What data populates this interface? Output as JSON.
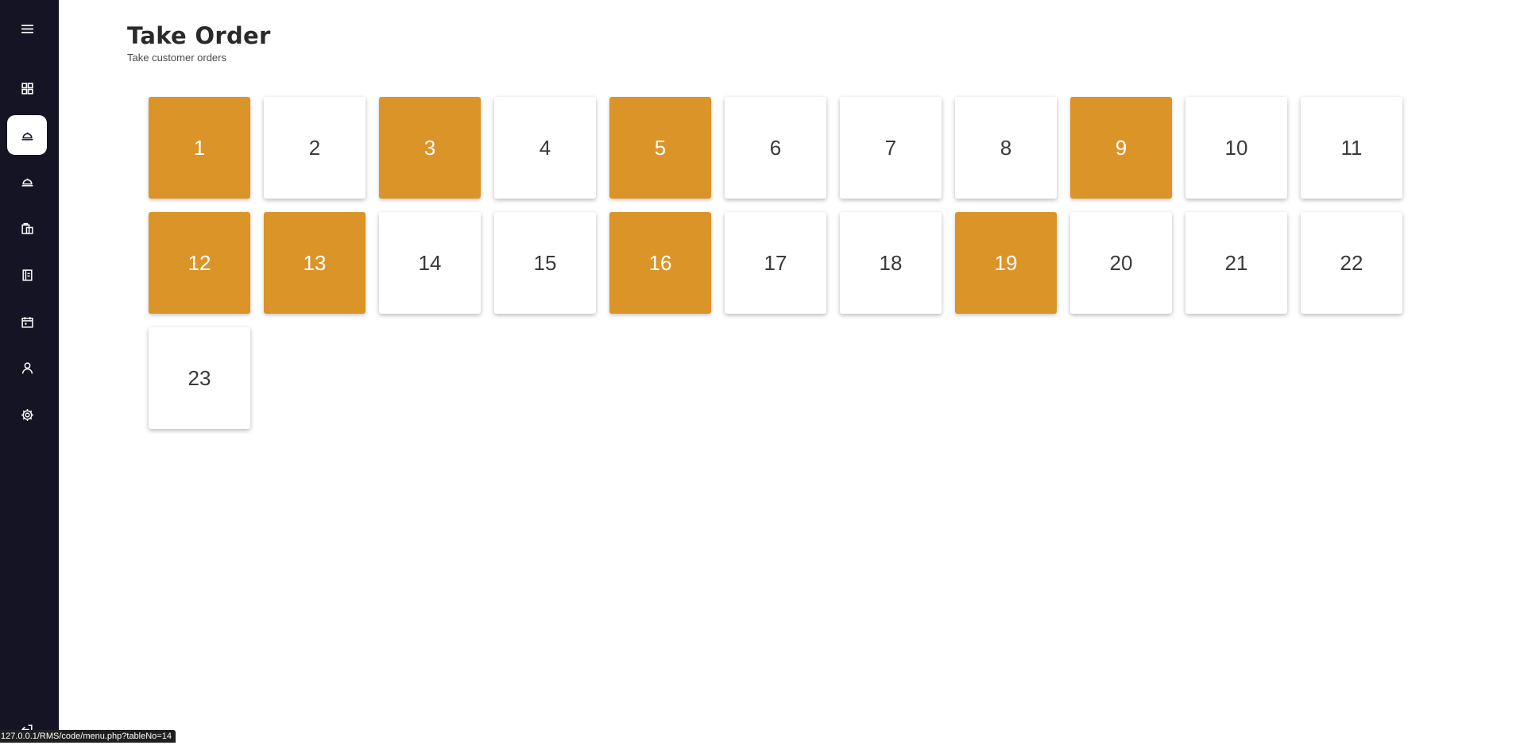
{
  "sidebar": {
    "items": [
      {
        "icon": "hamburger-menu-icon",
        "active": false
      },
      {
        "icon": "dashboard-grid-icon",
        "active": false
      },
      {
        "icon": "food-cloche-icon",
        "active": true
      },
      {
        "icon": "food-cloche-icon",
        "active": false
      },
      {
        "icon": "shopping-bags-icon",
        "active": false
      },
      {
        "icon": "menu-book-icon",
        "active": false
      },
      {
        "icon": "calendar-icon",
        "active": false
      },
      {
        "icon": "user-icon",
        "active": false
      },
      {
        "icon": "gear-icon",
        "active": false
      },
      {
        "icon": "logout-icon",
        "active": false
      }
    ]
  },
  "header": {
    "title": "Take Order",
    "subtitle": "Take customer orders"
  },
  "tables": [
    {
      "number": "1",
      "occupied": true
    },
    {
      "number": "2",
      "occupied": false
    },
    {
      "number": "3",
      "occupied": true
    },
    {
      "number": "4",
      "occupied": false
    },
    {
      "number": "5",
      "occupied": true
    },
    {
      "number": "6",
      "occupied": false
    },
    {
      "number": "7",
      "occupied": false
    },
    {
      "number": "8",
      "occupied": false
    },
    {
      "number": "9",
      "occupied": true
    },
    {
      "number": "10",
      "occupied": false
    },
    {
      "number": "11",
      "occupied": false
    },
    {
      "number": "12",
      "occupied": true
    },
    {
      "number": "13",
      "occupied": true
    },
    {
      "number": "14",
      "occupied": false
    },
    {
      "number": "15",
      "occupied": false
    },
    {
      "number": "16",
      "occupied": true
    },
    {
      "number": "17",
      "occupied": false
    },
    {
      "number": "18",
      "occupied": false
    },
    {
      "number": "19",
      "occupied": true
    },
    {
      "number": "20",
      "occupied": false
    },
    {
      "number": "21",
      "occupied": false
    },
    {
      "number": "22",
      "occupied": false
    },
    {
      "number": "23",
      "occupied": false
    }
  ],
  "status_bar": {
    "url": "127.0.0.1/RMS/code/menu.php?tableNo=14"
  },
  "colors": {
    "sidebar_bg": "#141424",
    "occupied": "#db9428",
    "free": "#ffffff"
  }
}
